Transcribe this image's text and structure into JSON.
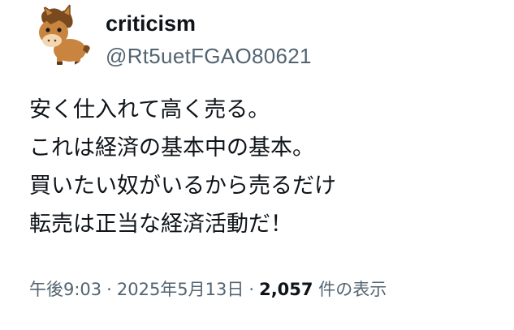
{
  "author": {
    "display_name": "criticism",
    "handle": "@Rt5uetFGAO80621",
    "avatar_icon": "horse-avatar-icon"
  },
  "tweet": {
    "lines": [
      "安く仕入れて高く売る。",
      "これは経済の基本中の基本。",
      "買いたい奴がいるから売るだけ",
      "転売は正当な経済活動だ！"
    ]
  },
  "meta": {
    "time": "午後9:03",
    "date": "2025年5月13日",
    "separator": "·",
    "views_count": "2,057",
    "views_label": "件の表示"
  },
  "colors": {
    "text_primary": "#0f1419",
    "text_secondary": "#536471",
    "horse_body": "#c9843f",
    "horse_mane": "#7a4a1f"
  }
}
